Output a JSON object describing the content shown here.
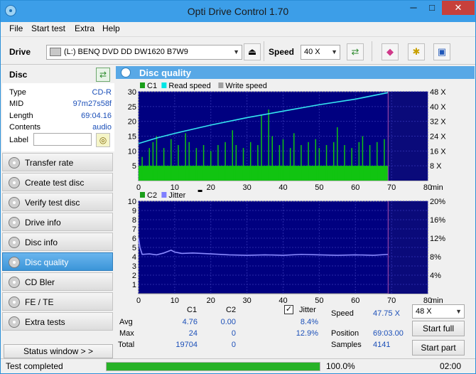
{
  "window": {
    "title": "Opti Drive Control 1.70"
  },
  "titlebar_buttons": {
    "minimize": "─",
    "maximize": "□",
    "close": "✕"
  },
  "menu": [
    "File",
    "Start test",
    "Extra",
    "Help"
  ],
  "toolbar": {
    "drive_label": "Drive",
    "drive_value": "(L:)  BENQ DVD DD DW1620 B7W9",
    "speed_label": "Speed",
    "speed_value": "40 X"
  },
  "disc": {
    "header": "Disc",
    "type_label": "Type",
    "type_value": "CD-R",
    "mid_label": "MID",
    "mid_value": "97m27s58f",
    "length_label": "Length",
    "length_value": "69:04.16",
    "contents_label": "Contents",
    "contents_value": "audio",
    "label_label": "Label",
    "label_value": ""
  },
  "nav": [
    {
      "label": "Transfer rate",
      "active": false
    },
    {
      "label": "Create test disc",
      "active": false
    },
    {
      "label": "Verify test disc",
      "active": false
    },
    {
      "label": "Drive info",
      "active": false
    },
    {
      "label": "Disc info",
      "active": false
    },
    {
      "label": "Disc quality",
      "active": true
    },
    {
      "label": "CD Bler",
      "active": false
    },
    {
      "label": "FE / TE",
      "active": false
    },
    {
      "label": "Extra tests",
      "active": false
    }
  ],
  "status_window_label": "Status window > >",
  "panel_title": "Disc quality",
  "chart_data": [
    {
      "type": "bar",
      "legend": [
        {
          "name": "C1",
          "color": "#1a9e1a"
        },
        {
          "name": "Read speed",
          "color": "#00e5e5"
        },
        {
          "name": "Write speed",
          "color": "#a0a0a0"
        }
      ],
      "x_ticks": [
        0,
        10,
        20,
        30,
        40,
        50,
        60,
        70,
        80
      ],
      "x_unit": "min",
      "xlim": [
        0,
        80
      ],
      "ylim_left": [
        0,
        30
      ],
      "y_ticks_left": [
        5,
        10,
        15,
        20,
        25,
        30
      ],
      "y_ticks_right": [
        "8 X",
        "16 X",
        "24 X",
        "32 X",
        "40 X",
        "48 X"
      ],
      "ylim_right": [
        0,
        48
      ],
      "data_end_min": 69.05,
      "c1_baseline": 5,
      "c1_spikes": [
        {
          "x": 1,
          "y": 8
        },
        {
          "x": 3,
          "y": 11
        },
        {
          "x": 4,
          "y": 13
        },
        {
          "x": 5,
          "y": 15
        },
        {
          "x": 7,
          "y": 11
        },
        {
          "x": 9,
          "y": 14
        },
        {
          "x": 11,
          "y": 12
        },
        {
          "x": 13,
          "y": 16
        },
        {
          "x": 14,
          "y": 13
        },
        {
          "x": 16,
          "y": 11
        },
        {
          "x": 18,
          "y": 12
        },
        {
          "x": 20,
          "y": 10
        },
        {
          "x": 22,
          "y": 12
        },
        {
          "x": 24,
          "y": 13
        },
        {
          "x": 26,
          "y": 17
        },
        {
          "x": 27,
          "y": 12
        },
        {
          "x": 29,
          "y": 11
        },
        {
          "x": 31,
          "y": 13
        },
        {
          "x": 33,
          "y": 12
        },
        {
          "x": 34,
          "y": 22
        },
        {
          "x": 36,
          "y": 24
        },
        {
          "x": 37,
          "y": 15
        },
        {
          "x": 39,
          "y": 12
        },
        {
          "x": 40,
          "y": 14
        },
        {
          "x": 42,
          "y": 11
        },
        {
          "x": 43,
          "y": 16
        },
        {
          "x": 45,
          "y": 12
        },
        {
          "x": 47,
          "y": 13
        },
        {
          "x": 49,
          "y": 14
        },
        {
          "x": 50,
          "y": 11
        },
        {
          "x": 52,
          "y": 12
        },
        {
          "x": 54,
          "y": 13
        },
        {
          "x": 55,
          "y": 18
        },
        {
          "x": 57,
          "y": 12
        },
        {
          "x": 59,
          "y": 11
        },
        {
          "x": 61,
          "y": 13
        },
        {
          "x": 62,
          "y": 15
        },
        {
          "x": 64,
          "y": 12
        },
        {
          "x": 66,
          "y": 13
        },
        {
          "x": 68,
          "y": 14
        }
      ],
      "read_speed": [
        {
          "x": 0,
          "y": 20
        },
        {
          "x": 5,
          "y": 23
        },
        {
          "x": 10,
          "y": 25.5
        },
        {
          "x": 20,
          "y": 30
        },
        {
          "x": 30,
          "y": 34
        },
        {
          "x": 40,
          "y": 37.5
        },
        {
          "x": 50,
          "y": 41
        },
        {
          "x": 60,
          "y": 44
        },
        {
          "x": 69,
          "y": 47.5
        }
      ]
    },
    {
      "type": "line",
      "legend": [
        {
          "name": "C2",
          "color": "#1a9e1a"
        },
        {
          "name": "Jitter",
          "color": "#7f7fff"
        }
      ],
      "x_ticks": [
        0,
        10,
        20,
        30,
        40,
        50,
        60,
        70,
        80
      ],
      "x_unit": "min",
      "xlim": [
        0,
        80
      ],
      "ylim_left": [
        0,
        10
      ],
      "y_ticks_left": [
        1,
        2,
        3,
        4,
        5,
        6,
        7,
        8,
        9,
        10
      ],
      "y_ticks_right": [
        "4%",
        "8%",
        "12%",
        "16%",
        "20%"
      ],
      "ylim_right": [
        0,
        20
      ],
      "data_end_min": 69.05,
      "c2_values": [],
      "jitter": [
        {
          "x": 0,
          "y": 12
        },
        {
          "x": 0.4,
          "y": 10
        },
        {
          "x": 1,
          "y": 8.5
        },
        {
          "x": 3,
          "y": 8.6
        },
        {
          "x": 5,
          "y": 8.4
        },
        {
          "x": 7,
          "y": 8.8
        },
        {
          "x": 9,
          "y": 9.4
        },
        {
          "x": 10,
          "y": 9
        },
        {
          "x": 12,
          "y": 8.7
        },
        {
          "x": 15,
          "y": 8.8
        },
        {
          "x": 20,
          "y": 8.6
        },
        {
          "x": 25,
          "y": 8.4
        },
        {
          "x": 30,
          "y": 8.3
        },
        {
          "x": 35,
          "y": 8.4
        },
        {
          "x": 40,
          "y": 8.3
        },
        {
          "x": 45,
          "y": 8.5
        },
        {
          "x": 50,
          "y": 8.4
        },
        {
          "x": 55,
          "y": 8.3
        },
        {
          "x": 60,
          "y": 8.4
        },
        {
          "x": 65,
          "y": 8.3
        },
        {
          "x": 69,
          "y": 8.5
        }
      ]
    }
  ],
  "stats": {
    "col_c1": "C1",
    "col_c2": "C2",
    "jitter_label": "Jitter",
    "jitter_checked": "✓",
    "avg_label": "Avg",
    "avg_c1": "4.76",
    "avg_c2": "0.00",
    "avg_jitter": "8.4%",
    "max_label": "Max",
    "max_c1": "24",
    "max_c2": "0",
    "max_jitter": "12.9%",
    "total_label": "Total",
    "total_c1": "19704",
    "total_c2": "0",
    "speed_label": "Speed",
    "speed_value": "47.75 X",
    "position_label": "Position",
    "position_value": "69:03.00",
    "samples_label": "Samples",
    "samples_value": "4141",
    "speed_select": "48 X",
    "start_full": "Start full",
    "start_part": "Start part"
  },
  "status": {
    "text": "Test completed",
    "progress_fraction": 1.0,
    "progress_text": "100.0%",
    "time": "02:00"
  }
}
